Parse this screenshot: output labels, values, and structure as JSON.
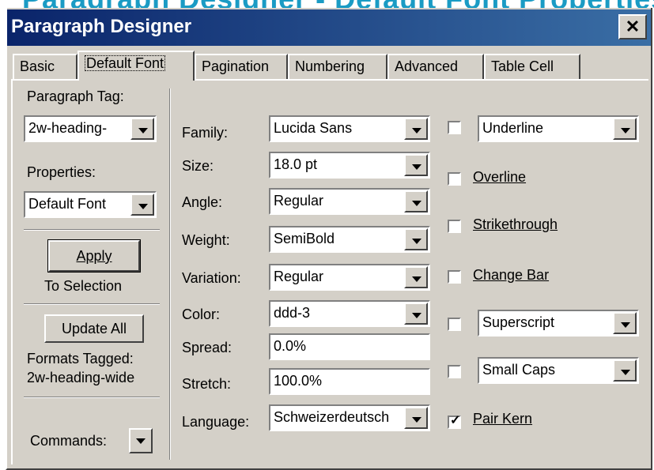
{
  "background": {
    "heading": "Paragraph Designer - Default Font Properties"
  },
  "window": {
    "title": "Paragraph Designer",
    "close_glyph": "✕"
  },
  "tabs": [
    {
      "label": "Basic"
    },
    {
      "label": "Default Font"
    },
    {
      "label": "Pagination"
    },
    {
      "label": "Numbering"
    },
    {
      "label": "Advanced"
    },
    {
      "label": "Table Cell"
    }
  ],
  "left": {
    "paragraph_tag_label": "Paragraph Tag:",
    "paragraph_tag_value": "2w-heading-",
    "properties_label": "Properties:",
    "properties_value": "Default Font",
    "apply_button": "Apply",
    "apply_subtitle": "To Selection",
    "update_all_button": "Update All",
    "formats_tagged_label": "Formats Tagged:",
    "formats_tagged_value": "2w-heading-wide",
    "commands_label": "Commands:"
  },
  "font": {
    "family_label": "Family:",
    "family": "Lucida Sans",
    "size_label": "Size:",
    "size": "18.0 pt",
    "angle_label": "Angle:",
    "angle": "Regular",
    "weight_label": "Weight:",
    "weight": "SemiBold",
    "variation_label": "Variation:",
    "variation": "Regular",
    "color_label": "Color:",
    "color": "ddd-3",
    "spread_label": "Spread:",
    "spread": "0.0%",
    "stretch_label": "Stretch:",
    "stretch": "100.0%",
    "language_label": "Language:",
    "language": "Schweizerdeutsch"
  },
  "effects": {
    "underline_value": "Underline",
    "underline_checked": false,
    "overline_label": "Overline",
    "overline_checked": false,
    "strikethrough_label": "Strikethrough",
    "strikethrough_checked": false,
    "change_bar_label": "Change Bar",
    "change_bar_checked": false,
    "superscript_value": "Superscript",
    "superscript_checked": false,
    "small_caps_value": "Small Caps",
    "small_caps_checked": false,
    "pair_kern_label": "Pair Kern",
    "pair_kern_checked": true
  },
  "colors": {
    "title_bar_start": "#0a246a",
    "title_bar_end": "#3a6ea5",
    "dialog_face": "#d4d0c8",
    "bg_heading": "#1a9bc4"
  }
}
